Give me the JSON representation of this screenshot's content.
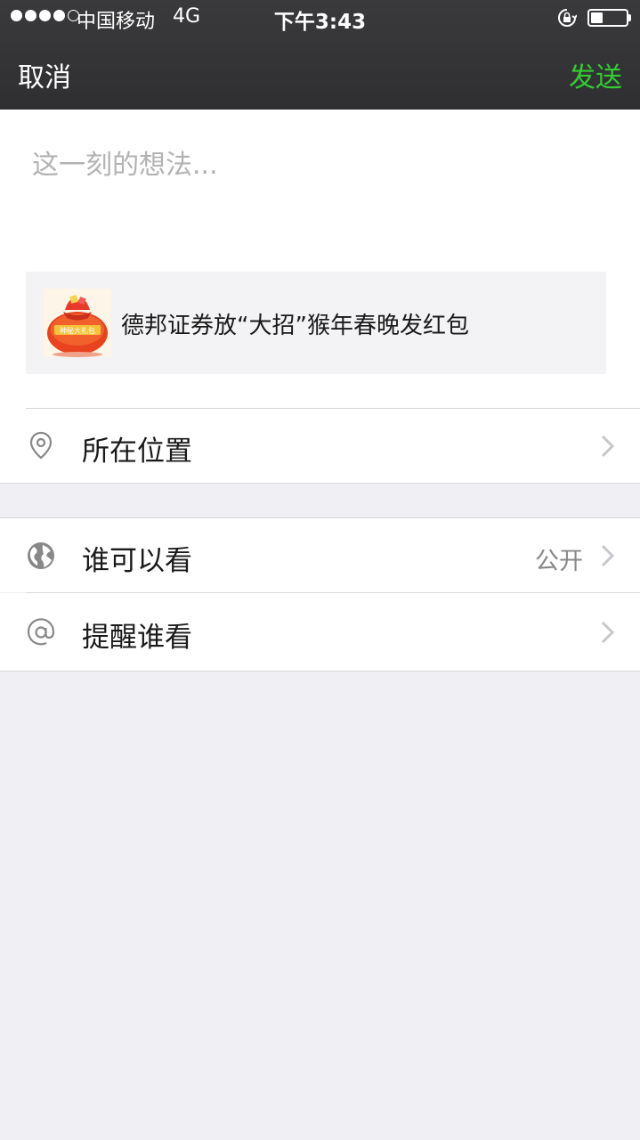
{
  "status_bar": {
    "carrier": "中国移动",
    "network": "4G",
    "time": "下午3:43",
    "signal_bars_filled": 4,
    "signal_bars_total": 5,
    "battery_level": 0.35
  },
  "nav": {
    "cancel_label": "取消",
    "send_label": "发送",
    "send_color": "#33cc33"
  },
  "compose": {
    "placeholder": "这一刻的想法...",
    "value": ""
  },
  "shared_link": {
    "title": "德邦证券放“大招”猴年春晚发红包",
    "thumbnail_text": "神秘大礼包"
  },
  "options": {
    "location_label": "所在位置",
    "visibility_label": "谁可以看",
    "visibility_value": "公开",
    "remind_label": "提醒谁看",
    "location_icon": "location-pin-icon",
    "visibility_icon": "globe-icon",
    "remind_icon": "at-sign-icon"
  }
}
